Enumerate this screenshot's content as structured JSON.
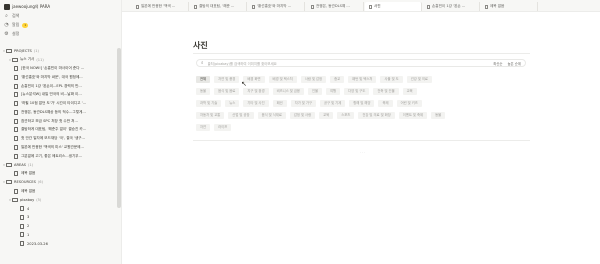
{
  "workspace": {
    "name": "jaewoojung의 PARA"
  },
  "nav": [
    {
      "icon": "search-icon",
      "glyph": "⌕",
      "label": "검색"
    },
    {
      "icon": "bell-icon",
      "glyph": "◔",
      "label": "알림",
      "badge": "1"
    },
    {
      "icon": "gear-icon",
      "glyph": "⚙",
      "label": "설정"
    }
  ],
  "tree": [
    {
      "type": "section",
      "label": "PROJECTS",
      "count": "(1)",
      "chev": "▾"
    },
    {
      "type": "folder",
      "label": "뉴스 기사",
      "count": "(11)",
      "chev": "▾"
    },
    {
      "type": "doc",
      "label": "[한국 NOW!] '손흥민이 마사이어 준다 ..."
    },
    {
      "type": "doc",
      "label": "'황선홍호'와 마지막 싸운', 대국 원정에..."
    },
    {
      "type": "doc",
      "label": "손흥민이 1강 '왼손이...EPL 경력의 만..."
    },
    {
      "type": "doc",
      "label": "[뉴스분석W] 내일 민국의 비...날짜 이..."
    },
    {
      "type": "doc",
      "label": "'하필 10점 없던 도'가' 시간이 타이디고 '..."
    },
    {
      "type": "doc",
      "label": "전쟁은, 동관DLS예상 등의 적수...그렇게..."
    },
    {
      "type": "doc",
      "label": "참관하고 보금 SPC 처장 첫 수반 처..."
    },
    {
      "type": "doc",
      "label": "결탐하게 대표팀, '해준주 없이' 결승진 카..."
    },
    {
      "type": "doc",
      "label": "첫 안간 일자에 모드재당 '국', 결국 '생구..."
    },
    {
      "type": "doc",
      "label": "일본에 반응한 '백색의 미스' 교원관문에..."
    },
    {
      "type": "doc",
      "label": "그분없에 고기, 좋은 메트리스...생기우..."
    },
    {
      "type": "section",
      "label": "AREAS",
      "count": "(1)",
      "chev": "▾"
    },
    {
      "type": "doc",
      "label": "제목 없음"
    },
    {
      "type": "section",
      "label": "RESOURCES",
      "count": "(6)",
      "chev": "▾"
    },
    {
      "type": "doc",
      "label": "제목 없음"
    },
    {
      "type": "folder",
      "label": "pixabay",
      "count": "(5)",
      "chev": "▾"
    },
    {
      "type": "doc",
      "label": "4"
    },
    {
      "type": "doc",
      "label": "3"
    },
    {
      "type": "doc",
      "label": "2"
    },
    {
      "type": "doc",
      "label": "1"
    },
    {
      "type": "doc",
      "label": "2023-03-26"
    }
  ],
  "tabs": [
    {
      "label": "일본에 반응한 '백색 ..."
    },
    {
      "label": "결탐의 대표팀, '해준 ..."
    },
    {
      "label": "'황선홍호'와 마지막 ..."
    },
    {
      "label": "전쟁은, 동관DLS예 ..."
    },
    {
      "label": "사진",
      "active": true
    },
    {
      "label": "손흥민이 1강 '왼손 ..."
    },
    {
      "label": "제목 없음"
    }
  ],
  "main": {
    "title": "사진",
    "search_placeholder": "출처(pixabay)를 검색하여 이미지를 찾아보세요",
    "search_opt1": "최신순",
    "search_opt2": "높은 순위",
    "loader": "· · ·"
  },
  "tag_rows": [
    [
      "전체",
      "자연 및 풍경",
      "배경 화면",
      "배경 및 텍스처",
      "사람 및 감정",
      "종교",
      "패턴 및 텍스처",
      "사물 및 도",
      "건강 및 의료"
    ],
    [
      "동물",
      "음식 및 음료",
      "지구 및 환경",
      "비즈니스 및 금융",
      "인물",
      "여행",
      "다양 및 구도",
      "건축 및 건물",
      "교육"
    ],
    [
      "과학 및 기술",
      "뉴스",
      "기타 및 사진",
      "패션",
      "자가 및 가구",
      "공구 및 기계",
      "항해 및 해양",
      "축제",
      "어린 및 키즈"
    ],
    [
      "자동차 및 교통",
      "산업 및 공장",
      "음식 및 식재료",
      "감정 및 사랑",
      "교육",
      "스포츠",
      "건강 및 의료 및 화장",
      "이벤트 및 축제",
      "동물"
    ],
    [
      "자연",
      "라이프"
    ]
  ],
  "colors": {
    "accent": "#ffd43b",
    "sidebar_bg": "#f7f7f5",
    "text": "#37352f"
  }
}
